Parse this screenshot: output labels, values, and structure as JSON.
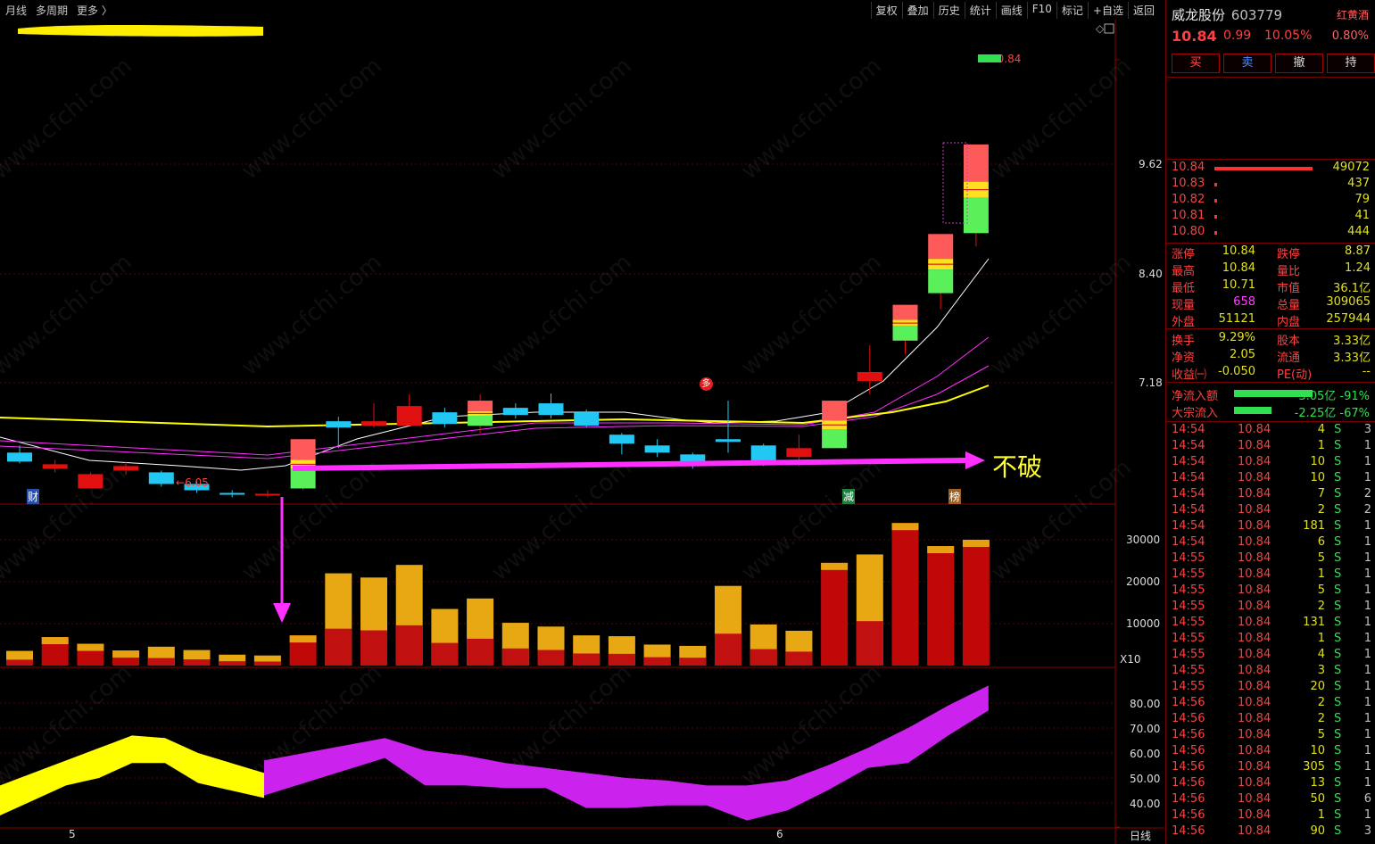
{
  "toolbar": {
    "left": [
      "月线",
      "多周期",
      "更多 〉"
    ],
    "right": [
      "复权",
      "叠加",
      "历史",
      "统计",
      "画线",
      "F10",
      "标记",
      "+自选",
      "返回"
    ]
  },
  "chart": {
    "price_axis": [
      "9.62",
      "8.40",
      "7.18"
    ],
    "vol_axis": [
      "30000",
      "20000",
      "10000"
    ],
    "vol_unit": "X10",
    "ind_axis": [
      "80.00",
      "70.00",
      "60.00",
      "50.00",
      "40.00"
    ],
    "x_labels": [
      "5",
      "6"
    ],
    "period_label": "日线",
    "high_label": "10.84",
    "low_label": "6.05",
    "annotation": "不破",
    "markers": {
      "cai": "财",
      "jian": "减",
      "bang": "榜",
      "duo": "多"
    },
    "watermark": "www.cfchi.com",
    "colors": {
      "up": "#e01010",
      "down": "#20c8f0",
      "ma1": "#ffffff",
      "ma2": "#ff30ff",
      "ma3": "#ffff00",
      "ind_a": "#ffff00",
      "ind_b": "#cc22ee"
    }
  },
  "chart_data": {
    "type": "candlestick",
    "candles": [
      [
        6.4,
        6.3,
        6.48,
        6.28
      ],
      [
        6.22,
        6.27,
        6.32,
        6.18
      ],
      [
        6.0,
        6.16,
        6.18,
        6.0
      ],
      [
        6.2,
        6.25,
        6.3,
        6.15
      ],
      [
        6.18,
        6.05,
        6.2,
        6.02
      ],
      [
        6.05,
        5.98,
        6.08,
        5.95
      ],
      [
        5.95,
        5.94,
        5.98,
        5.9
      ],
      [
        5.92,
        5.94,
        5.98,
        5.9
      ],
      [
        6.0,
        6.55,
        6.55,
        5.98
      ],
      [
        6.75,
        6.68,
        6.8,
        6.45
      ],
      [
        6.7,
        6.75,
        6.95,
        6.68
      ],
      [
        6.7,
        6.92,
        7.05,
        6.7
      ],
      [
        6.85,
        6.72,
        6.9,
        6.68
      ],
      [
        6.7,
        6.98,
        7.05,
        6.62
      ],
      [
        6.9,
        6.82,
        6.95,
        6.78
      ],
      [
        6.95,
        6.82,
        7.06,
        6.78
      ],
      [
        6.85,
        6.7,
        6.88,
        6.68
      ],
      [
        6.6,
        6.5,
        6.62,
        6.38
      ],
      [
        6.48,
        6.4,
        6.55,
        6.35
      ],
      [
        6.38,
        6.25,
        6.4,
        6.22
      ],
      [
        6.55,
        6.52,
        6.98,
        6.4
      ],
      [
        6.48,
        6.3,
        6.5,
        6.25
      ],
      [
        6.35,
        6.45,
        6.6,
        6.25
      ],
      [
        6.45,
        6.98,
        6.98,
        6.45
      ],
      [
        7.2,
        7.3,
        7.6,
        7.05
      ],
      [
        7.65,
        8.05,
        8.05,
        7.5
      ],
      [
        8.18,
        8.84,
        8.84,
        8.0
      ],
      [
        8.85,
        9.84,
        9.84,
        8.7
      ]
    ],
    "volume": [
      [
        3500,
        0
      ],
      [
        6800,
        1
      ],
      [
        5200,
        1
      ],
      [
        3600,
        1
      ],
      [
        4500,
        0
      ],
      [
        3700,
        0
      ],
      [
        2600,
        0
      ],
      [
        2400,
        0
      ],
      [
        7200,
        1
      ],
      [
        22000,
        0
      ],
      [
        21000,
        0
      ],
      [
        24000,
        0
      ],
      [
        13500,
        0
      ],
      [
        16000,
        0
      ],
      [
        10200,
        0
      ],
      [
        9300,
        0
      ],
      [
        7200,
        0
      ],
      [
        7000,
        0
      ],
      [
        5000,
        0
      ],
      [
        4700,
        0
      ],
      [
        19000,
        0
      ],
      [
        9800,
        0
      ],
      [
        8300,
        0
      ],
      [
        24500,
        1
      ],
      [
        26500,
        0
      ],
      [
        34000,
        1
      ],
      [
        28500,
        1
      ],
      [
        30000,
        1
      ]
    ],
    "indicator_a": [
      47,
      52,
      57,
      62,
      67,
      66,
      60,
      56,
      52
    ],
    "indicator_b": [
      57,
      60,
      63,
      66,
      61,
      59,
      56,
      54,
      52,
      50,
      49,
      47,
      47,
      49,
      55,
      62,
      70,
      79,
      87
    ]
  },
  "panel": {
    "name": "威龙股份",
    "code": "603779",
    "tag1": "红黄酒",
    "tag2": "0.80%",
    "price": "10.84",
    "change": "0.99",
    "pct": "10.05%",
    "buttons": [
      "买",
      "卖",
      "撤",
      "持"
    ],
    "orderbook": [
      {
        "p": "10.84",
        "v": "49072",
        "w": 110
      },
      {
        "p": "10.83",
        "v": "437",
        "w": 3
      },
      {
        "p": "10.82",
        "v": "79",
        "w": 3
      },
      {
        "p": "10.81",
        "v": "41",
        "w": 3
      },
      {
        "p": "10.80",
        "v": "444",
        "w": 3
      }
    ],
    "stats": [
      [
        "涨停",
        "10.84",
        "跌停",
        "8.87"
      ],
      [
        "最高",
        "10.84",
        "量比",
        "1.24"
      ],
      [
        "最低",
        "10.71",
        "市值",
        "36.1亿"
      ],
      [
        "现量",
        "658",
        "总量",
        "309065"
      ],
      [
        "外盘",
        "51121",
        "内盘",
        "257944"
      ]
    ],
    "stats2": [
      [
        "换手",
        "9.29%",
        "股本",
        "3.33亿"
      ],
      [
        "净资",
        "2.05",
        "流通",
        "3.33亿"
      ],
      [
        "收益㈠",
        "-0.050",
        "PE(动)",
        "--"
      ]
    ],
    "flows": [
      {
        "n": "净流入额",
        "v": "-3.05亿 -91%",
        "w": 88
      },
      {
        "n": "大宗流入",
        "v": "-2.25亿 -67%",
        "w": 42
      }
    ],
    "trades": [
      [
        "14:54",
        "10.84",
        "4",
        "S",
        "3"
      ],
      [
        "14:54",
        "10.84",
        "1",
        "S",
        "1"
      ],
      [
        "14:54",
        "10.84",
        "10",
        "S",
        "1"
      ],
      [
        "14:54",
        "10.84",
        "10",
        "S",
        "1"
      ],
      [
        "14:54",
        "10.84",
        "7",
        "S",
        "2"
      ],
      [
        "14:54",
        "10.84",
        "2",
        "S",
        "2"
      ],
      [
        "14:54",
        "10.84",
        "181",
        "S",
        "1"
      ],
      [
        "14:54",
        "10.84",
        "6",
        "S",
        "1"
      ],
      [
        "14:55",
        "10.84",
        "5",
        "S",
        "1"
      ],
      [
        "14:55",
        "10.84",
        "1",
        "S",
        "1"
      ],
      [
        "14:55",
        "10.84",
        "5",
        "S",
        "1"
      ],
      [
        "14:55",
        "10.84",
        "2",
        "S",
        "1"
      ],
      [
        "14:55",
        "10.84",
        "131",
        "S",
        "1"
      ],
      [
        "14:55",
        "10.84",
        "1",
        "S",
        "1"
      ],
      [
        "14:55",
        "10.84",
        "4",
        "S",
        "1"
      ],
      [
        "14:55",
        "10.84",
        "3",
        "S",
        "1"
      ],
      [
        "14:55",
        "10.84",
        "20",
        "S",
        "1"
      ],
      [
        "14:56",
        "10.84",
        "2",
        "S",
        "1"
      ],
      [
        "14:56",
        "10.84",
        "2",
        "S",
        "1"
      ],
      [
        "14:56",
        "10.84",
        "5",
        "S",
        "1"
      ],
      [
        "14:56",
        "10.84",
        "10",
        "S",
        "1"
      ],
      [
        "14:56",
        "10.84",
        "305",
        "S",
        "1"
      ],
      [
        "14:56",
        "10.84",
        "13",
        "S",
        "1"
      ],
      [
        "14:56",
        "10.84",
        "50",
        "S",
        "6"
      ],
      [
        "14:56",
        "10.84",
        "1",
        "S",
        "1"
      ],
      [
        "14:56",
        "10.84",
        "90",
        "S",
        "3"
      ]
    ]
  }
}
